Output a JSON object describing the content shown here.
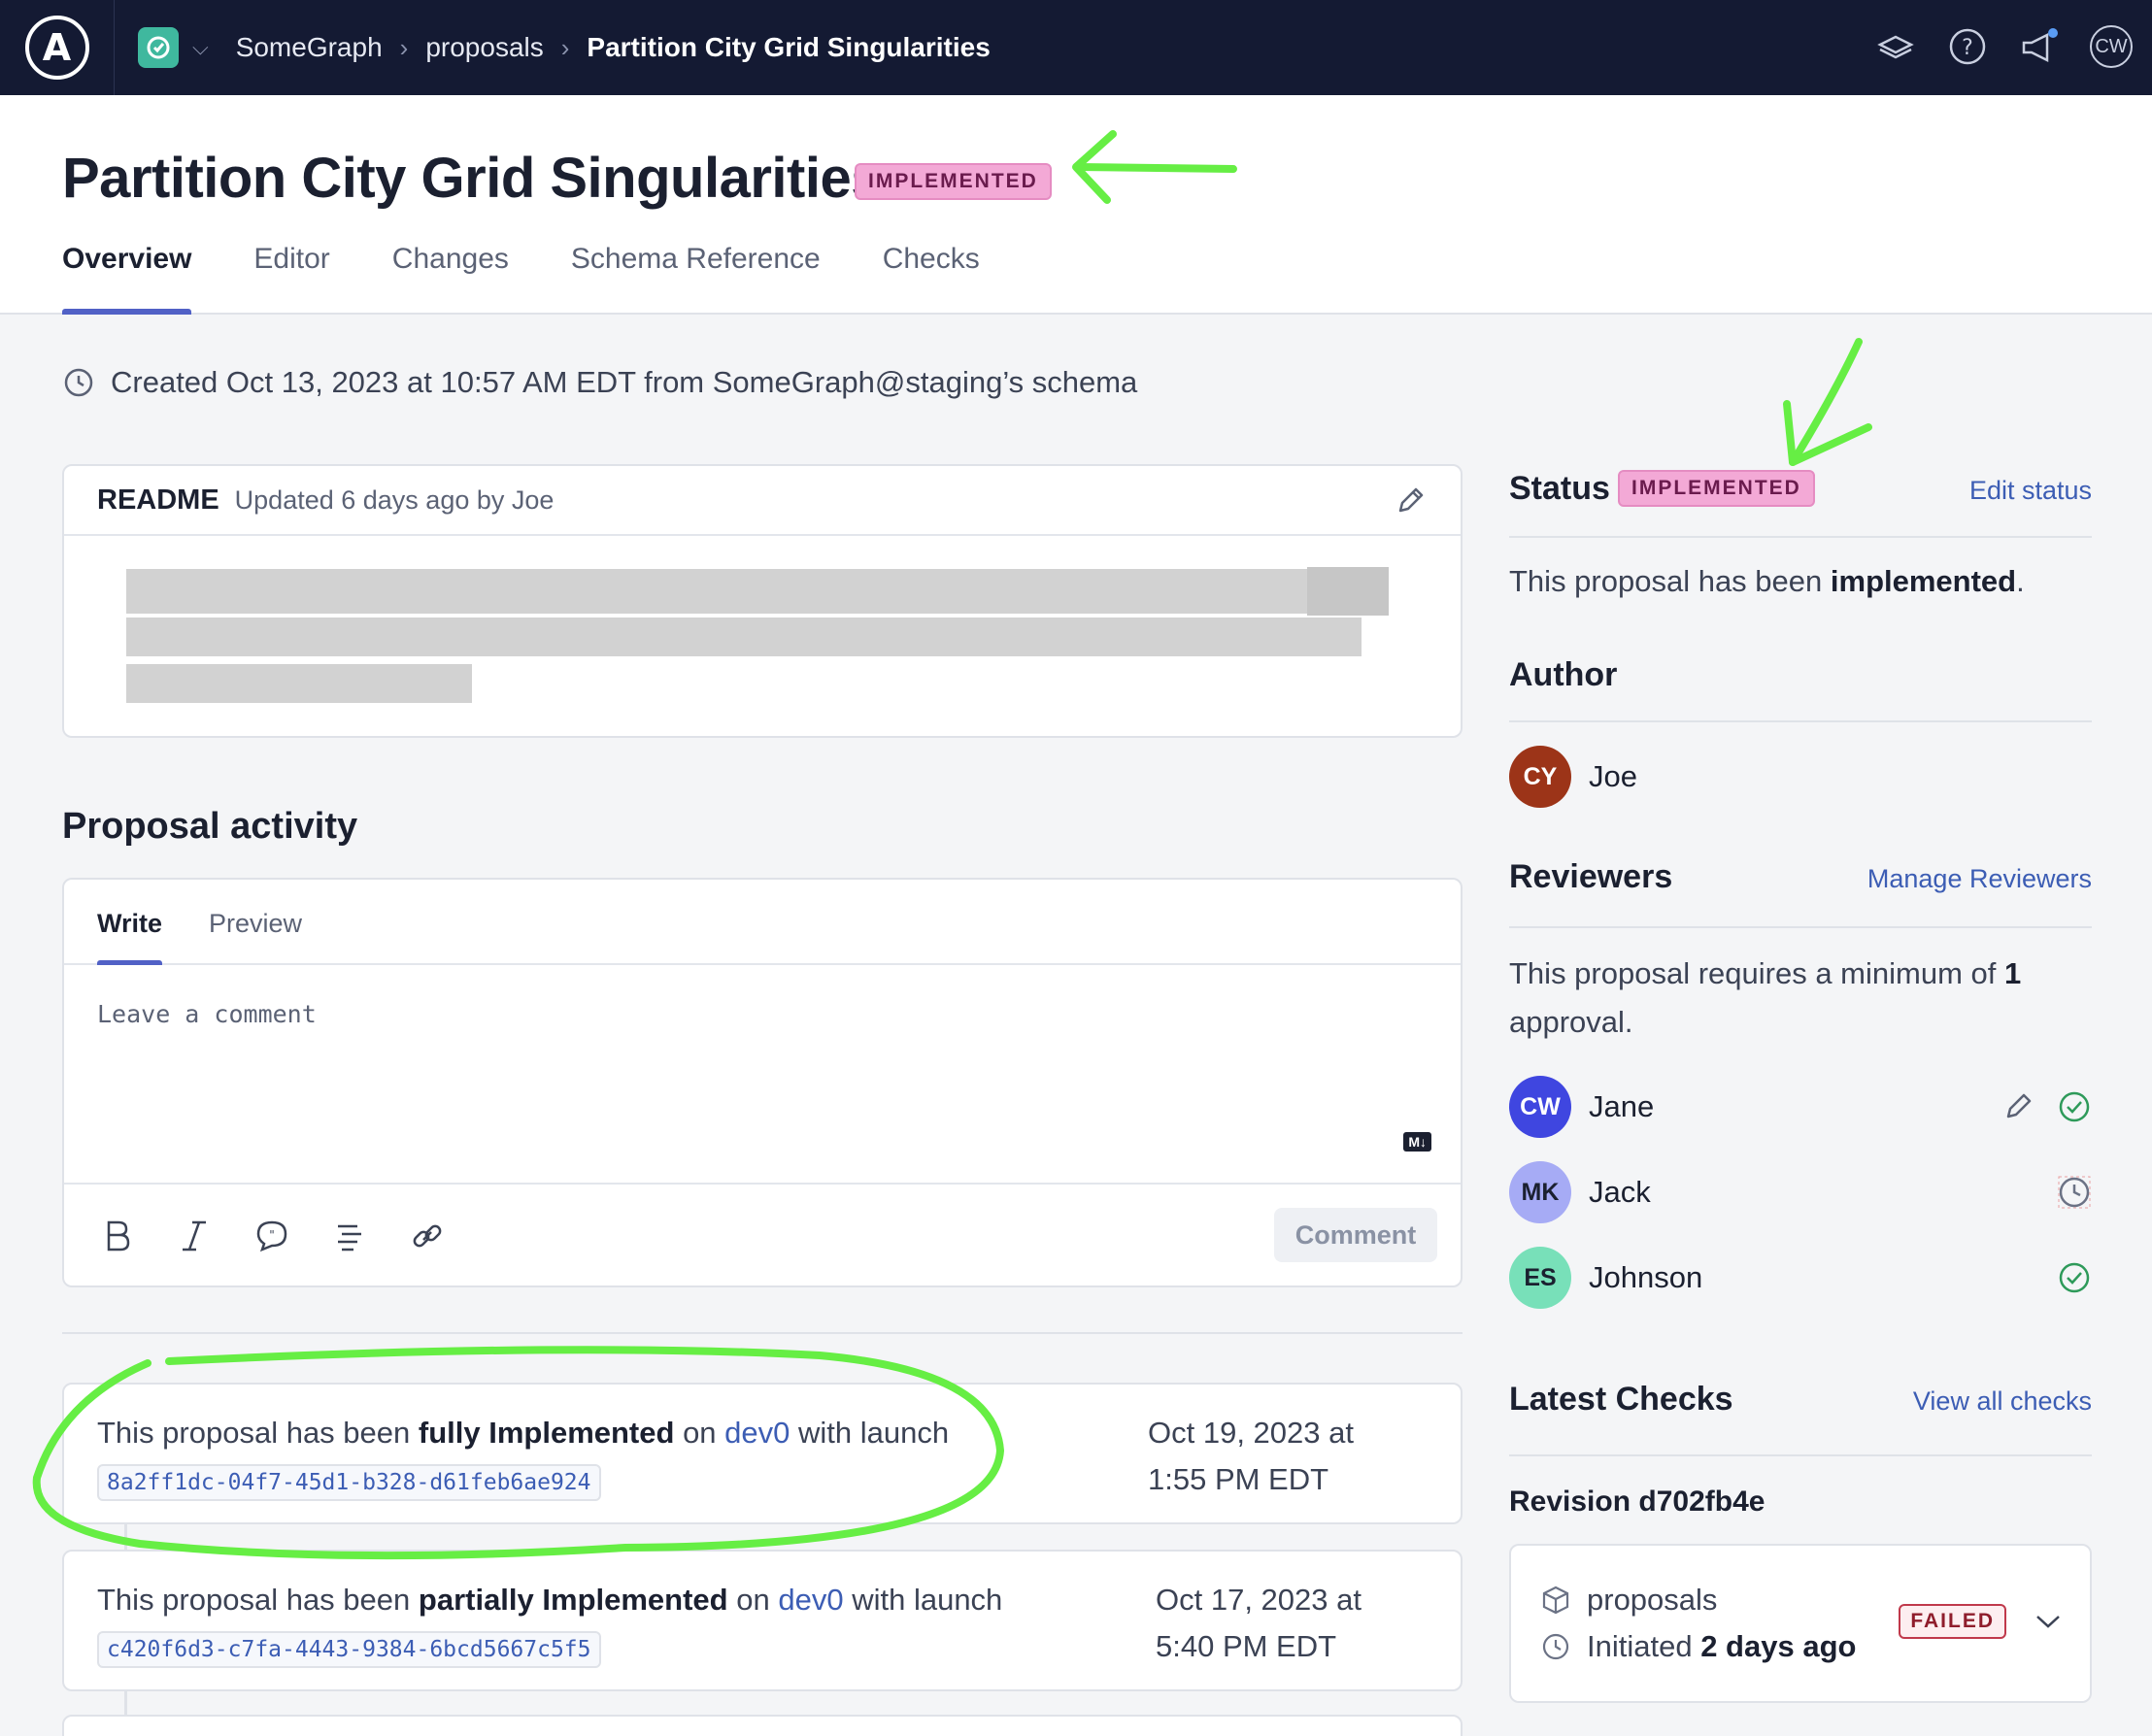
{
  "nav": {
    "logo_letter": "A",
    "breadcrumbs": [
      "SomeGraph",
      "proposals",
      "Partition City Grid Singularities"
    ],
    "avatar_initials": "CW",
    "icons": [
      "learn-icon",
      "help-icon",
      "announcements-icon"
    ]
  },
  "header": {
    "title": "Partition City Grid Singularities",
    "status_badge": "IMPLEMENTED",
    "tabs": [
      "Overview",
      "Editor",
      "Changes",
      "Schema Reference",
      "Checks"
    ]
  },
  "created_text": "Created Oct 13, 2023 at 10:57 AM EDT from SomeGraph@staging’s schema",
  "readme": {
    "label": "README",
    "updated": "Updated 6 days ago by Joe"
  },
  "activity": {
    "title": "Proposal activity",
    "editor_tabs": [
      "Write",
      "Preview"
    ],
    "placeholder": "Leave a comment",
    "markdown_badge": "M↓",
    "comment_button": "Comment",
    "items": [
      {
        "prefix": "This proposal has been",
        "emphasis": "fully Implemented",
        "mid": "on",
        "variant": "dev0",
        "suffix": "with launch",
        "launch_id": "8a2ff1dc-04f7-45d1-b328-d61feb6ae924",
        "date": "Oct 19, 2023 at 1:55 PM EDT"
      },
      {
        "prefix": "This proposal has been",
        "emphasis": "partially Implemented",
        "mid": "on",
        "variant": "dev0",
        "suffix": "with launch",
        "launch_id": "c420f6d3-c7fa-4443-9384-6bcd5667c5f5",
        "date": "Oct 17, 2023 at 5:40 PM EDT"
      }
    ]
  },
  "sidebar": {
    "status": {
      "title": "Status",
      "badge": "IMPLEMENTED",
      "edit_link": "Edit status",
      "text_prefix": "This proposal has been",
      "text_bold": "implemented",
      "text_suffix": "."
    },
    "author": {
      "title": "Author",
      "initials": "CY",
      "name": "Joe",
      "color": "#9c3418"
    },
    "reviewers": {
      "title": "Reviewers",
      "manage_link": "Manage Reviewers",
      "req_prefix": "This proposal requires a minimum of",
      "req_count": "1",
      "req_suffix": "approval.",
      "people": [
        {
          "initials": "CW",
          "name": "Jane",
          "color": "#3f46e0",
          "state": "approved"
        },
        {
          "initials": "MK",
          "name": "Jack",
          "color": "#a6abf5",
          "state": "pending"
        },
        {
          "initials": "ES",
          "name": "Johnson",
          "color": "#78e0b9",
          "state": "approved"
        }
      ]
    },
    "checks": {
      "title": "Latest Checks",
      "view_link": "View all checks",
      "revision": "Revision d702fb4e",
      "variant": "proposals",
      "initiated_prefix": "Initiated",
      "initiated_bold": "2 days ago",
      "status": "FAILED"
    }
  },
  "colors": {
    "nav_bg": "#141a33",
    "implemented_badge": "#f3a9d6",
    "accent": "#5161c6",
    "link": "#3c5db4",
    "annotation": "#66ee44"
  }
}
